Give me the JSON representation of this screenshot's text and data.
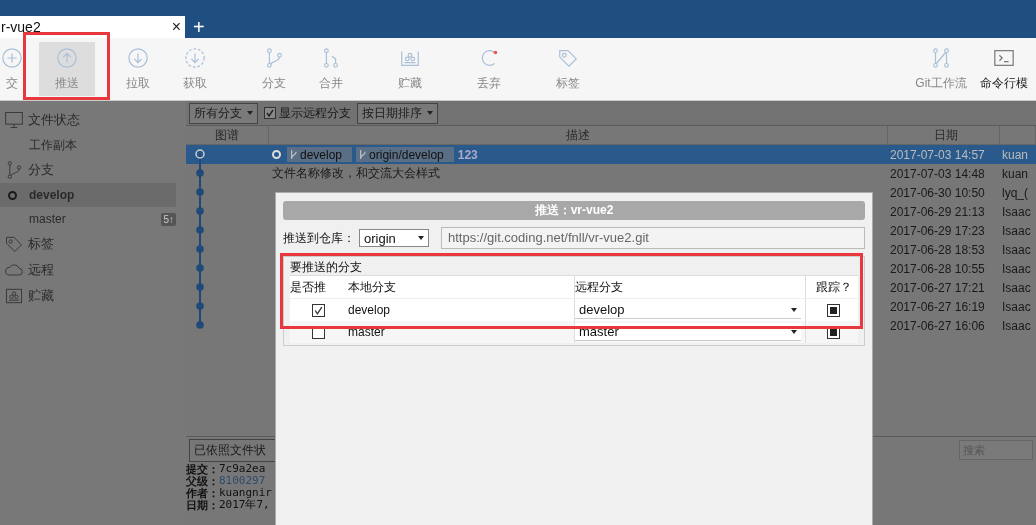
{
  "tab": {
    "title": "r-vue2",
    "close": "×",
    "add": "+"
  },
  "toolbar": {
    "items": [
      {
        "label": "交",
        "selected": false
      },
      {
        "label": "推送",
        "selected": true,
        "highlighted": true
      },
      {
        "label": "拉取",
        "selected": false
      },
      {
        "label": "获取",
        "selected": false
      },
      {
        "label": "分支",
        "selected": false
      },
      {
        "label": "合并",
        "selected": false
      },
      {
        "label": "贮藏",
        "selected": false
      },
      {
        "label": "丢弃",
        "selected": false
      },
      {
        "label": "标签",
        "selected": false
      }
    ],
    "right_items": [
      {
        "label": "Git工作流"
      },
      {
        "label": "命令行模"
      }
    ]
  },
  "sidebar": {
    "sections": [
      {
        "label": "文件状态",
        "children": [
          {
            "label": "工作副本",
            "selected": false
          }
        ]
      },
      {
        "label": "分支",
        "children": [
          {
            "label": "develop",
            "selected": true,
            "current": true
          },
          {
            "label": "master",
            "selected": false,
            "current": false,
            "badge": "5↑"
          }
        ]
      },
      {
        "label": "标签"
      },
      {
        "label": "远程"
      },
      {
        "label": "贮藏"
      }
    ]
  },
  "filters": {
    "branches": "所有分支",
    "show_remote": {
      "label": "显示远程分支",
      "checked": true
    },
    "sort": "按日期排序"
  },
  "log": {
    "columns": [
      "图谱",
      "描述",
      "日期"
    ],
    "rows": [
      {
        "selected": true,
        "refs": [
          "develop",
          "origin/develop"
        ],
        "description": "123",
        "date": "2017-07-03 14:57",
        "author": "kuan"
      },
      {
        "selected": false,
        "refs": [],
        "description": "文件名称修改，和交流大会样式",
        "date": "2017-07-03 14:48",
        "author": "kuan"
      },
      {
        "selected": false,
        "refs": [],
        "description": "",
        "date": "2017-06-30 10:50",
        "author": "lyq_("
      },
      {
        "selected": false,
        "refs": [],
        "description": "",
        "date": "2017-06-29 21:13",
        "author": "Isaac"
      },
      {
        "selected": false,
        "refs": [],
        "description": "",
        "date": "2017-06-29 17:23",
        "author": "Isaac"
      },
      {
        "selected": false,
        "refs": [],
        "description": "",
        "date": "2017-06-28 18:53",
        "author": "Isaac"
      },
      {
        "selected": false,
        "refs": [],
        "description": "",
        "date": "2017-06-28 10:55",
        "author": "Isaac"
      },
      {
        "selected": false,
        "refs": [],
        "description": "",
        "date": "2017-06-27 17:21",
        "author": "Isaac"
      },
      {
        "selected": false,
        "refs": [],
        "description": "",
        "date": "2017-06-27 16:19",
        "author": "Isaac"
      },
      {
        "selected": false,
        "refs": [],
        "description": "",
        "date": "2017-06-27 16:06",
        "author": "Isaac"
      }
    ]
  },
  "details": {
    "view_mode": "已依照文件状",
    "search": {
      "placeholder": "搜索"
    },
    "lines": [
      {
        "label": "提交：",
        "value": "7c9a2ea",
        "kind": "text"
      },
      {
        "label": "父级：",
        "value": "8100297",
        "kind": "link"
      },
      {
        "label": "作者：",
        "value": "kuangnir",
        "kind": "text"
      },
      {
        "label": "日期：",
        "value": "2017年7,",
        "kind": "text"
      }
    ]
  },
  "dialog": {
    "title": "推送：vr-vue2",
    "repo_label": "推送到仓库：",
    "repo": "origin",
    "url": "https://git.coding.net/fnll/vr-vue2.git",
    "group": {
      "title": "要推送的分支",
      "highlighted": true,
      "columns": [
        "是否推",
        "本地分支",
        "远程分支",
        "跟踪？"
      ],
      "rows": [
        {
          "push": true,
          "local": "develop",
          "remote": "develop",
          "track": true
        },
        {
          "push": false,
          "local": "master",
          "remote": "master",
          "track": true
        }
      ]
    }
  }
}
